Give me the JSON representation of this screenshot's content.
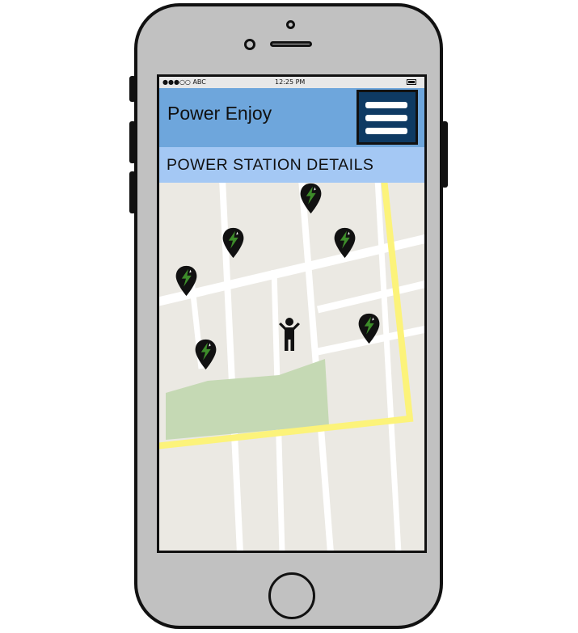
{
  "status_bar": {
    "carrier": "●●●○○ ABC",
    "time": "12:25 PM"
  },
  "header": {
    "title": "Power Enjoy",
    "menu_icon": "hamburger-menu-icon"
  },
  "subheader": {
    "title": "POWER STATION DETAILS"
  },
  "map": {
    "station_icon": "charging-station-pin-icon",
    "user_icon": "person-location-icon",
    "station_count": 6
  },
  "colors": {
    "header": "#6ea6dc",
    "subheader": "#a4c8f4",
    "menu_button": "#0e3a63",
    "map_bg": "#ebe9e3",
    "road": "#ffffff",
    "highway": "#fcf37a",
    "park": "#c5d9b4",
    "pin_bolt": "#3d8c2a",
    "phone_body": "#c1c1c1"
  }
}
